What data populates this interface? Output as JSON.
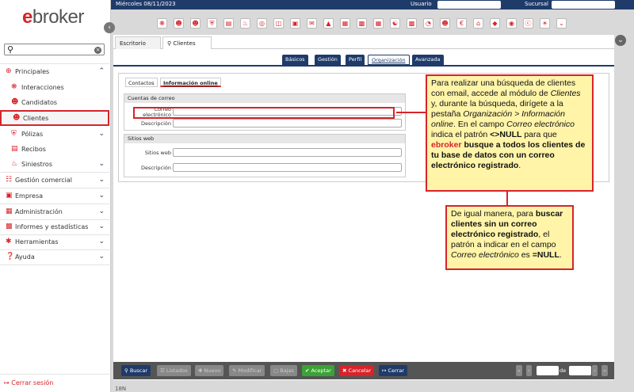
{
  "brand": {
    "e": "e",
    "rest": "broker"
  },
  "sidebar": {
    "search_placeholder": "",
    "items": [
      {
        "label": "Principales",
        "icon": "circle-plus-icon"
      },
      {
        "label": "Interacciones",
        "icon": "gear-network-icon"
      },
      {
        "label": "Candidatos",
        "icon": "user-plus-icon"
      },
      {
        "label": "Clientes",
        "icon": "user-icon"
      },
      {
        "label": "Pólizas",
        "icon": "shield-icon"
      },
      {
        "label": "Recibos",
        "icon": "receipt-icon"
      },
      {
        "label": "Siniestros",
        "icon": "fire-icon"
      },
      {
        "label": "Gestión comercial",
        "icon": "cart-icon"
      },
      {
        "label": "Empresa",
        "icon": "building-icon"
      },
      {
        "label": "Administración",
        "icon": "calculator-icon"
      },
      {
        "label": "Informes y estadísticas",
        "icon": "bar-chart-icon"
      },
      {
        "label": "Herramientas",
        "icon": "wrench-icon"
      },
      {
        "label": "Ayuda",
        "icon": "help-icon"
      }
    ],
    "logout": "Cerrar sesión"
  },
  "topbar": {
    "date": "Miércoles 08/11/2023",
    "user_label": "Usuario",
    "branch_label": "Sucursal"
  },
  "tabs_top": [
    "Escritorio",
    "Clientes"
  ],
  "tabs_mid": [
    "Básicos",
    "Gestión",
    "Perfil",
    "Organización",
    "Avanzada"
  ],
  "inner_tabs": [
    "Contactos",
    "Información online"
  ],
  "sections": {
    "emails": {
      "title": "Cuentas de correo",
      "f1": "Correo electrónico",
      "f2": "Descripción"
    },
    "web": {
      "title": "Sitios web",
      "f1": "Sitios web",
      "f2": "Descripción"
    }
  },
  "callout1": {
    "p1": "Para realizar una búsqueda de clientes con email, accede al módulo de ",
    "p2": "Clientes",
    "p3": " y, durante la búsqueda, dirígete a la pestaña ",
    "p4": "Organización > Información online",
    "p5": ". En el campo ",
    "p6": "Correo electrónico",
    "p7": " indica el patrón ",
    "p8": "<>NULL",
    "p9": " para que ",
    "p10": "ebroker",
    "p11": " busque a todos los clientes de tu base de datos con un correo electrónico registrado",
    "p12": "."
  },
  "callout2": {
    "p1": "De igual manera, para ",
    "p2": "buscar clientes sin un correo electrónico registrado",
    "p3": ", el patrón a indicar en el campo ",
    "p4": "Correo electrónico",
    "p5": " es ",
    "p6": "=NULL",
    "p7": "."
  },
  "bottom": {
    "buscar": "Buscar",
    "listados": "Listados",
    "nuevo": "Nuevo",
    "modificar": "Modificar",
    "bajas": "Bajas",
    "aceptar": "Aceptar",
    "cancelar": "Cancelar",
    "cerrar": "Cerrar",
    "de": "de"
  },
  "footer": "18N",
  "colors": {
    "accent": "#d8232a",
    "navy": "#1f3b6a",
    "callout_bg": "#fff4a8",
    "accept": "#3aa335"
  }
}
